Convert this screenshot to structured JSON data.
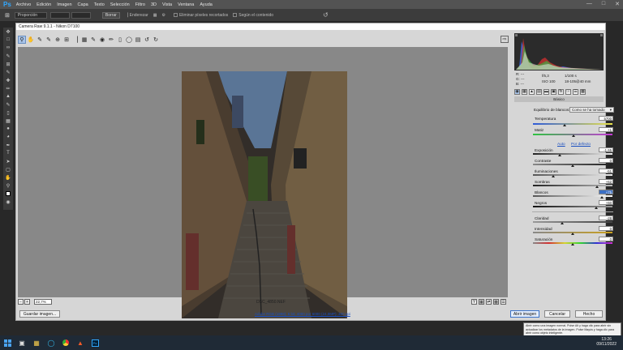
{
  "app": {
    "logo": "Ps",
    "menus": [
      "Archivo",
      "Edición",
      "Imagen",
      "Capa",
      "Texto",
      "Selección",
      "Filtro",
      "3D",
      "Vista",
      "Ventana",
      "Ayuda"
    ]
  },
  "options": {
    "style_value": "Proporción",
    "clear_label": "Borrar",
    "straighten_label": "Enderezar",
    "delete_cropped_label": "Eliminar píxeles recortados",
    "content_aware_label": "Según el contenido"
  },
  "dialog": {
    "title": "Camera Raw 9.1.1 - Nikon D7100",
    "zoom": "22,7%",
    "filename": "DSC_4850.NEF",
    "workflow_info": "Adobe RGB (1998); 8 bit; 4000 por 6000 (24,0MP); 300 ppi",
    "save_label": "Guardar imagen...",
    "open_label": "Abrir imagen",
    "cancel_label": "Cancelar",
    "done_label": "Hecho"
  },
  "readout": {
    "r": "R:",
    "g": "G:",
    "b": "B:",
    "dash": "---",
    "aperture": "f/5,3",
    "shutter": "1/100 s",
    "iso": "ISO 100",
    "lens": "18-105@40 mm"
  },
  "panel": {
    "title": "Básico",
    "wb_label": "Equilibrio de blancos:",
    "wb_value": "Como se ha tomado",
    "temp_label": "Temperatura",
    "temp_value": "5700",
    "tint_label": "Matiz",
    "tint_value": "+1",
    "auto_label": "Auto",
    "default_label": "Por defecto",
    "sliders": [
      {
        "label": "Exposición",
        "value": "-1,65"
      },
      {
        "label": "Contraste",
        "value": "0"
      },
      {
        "label": "Iluminaciones",
        "value": "-51"
      },
      {
        "label": "Sombras",
        "value": "+62"
      },
      {
        "label": "Blancos",
        "value": "+75"
      },
      {
        "label": "Negros",
        "value": "+60"
      }
    ],
    "presence": [
      {
        "label": "Claridad",
        "value": "-28"
      },
      {
        "label": "Intensidad",
        "value": "0"
      },
      {
        "label": "Saturación",
        "value": "0"
      }
    ]
  },
  "tooltip": "Abrir como una imagen normal. Pulse Alt y haga clic para abrir sin actualizar los metadatos de la imagen. Pulse Mayús y haga clic para abrir como objeto inteligente.",
  "clock": {
    "time": "13:26",
    "date": "09/11/2022"
  }
}
